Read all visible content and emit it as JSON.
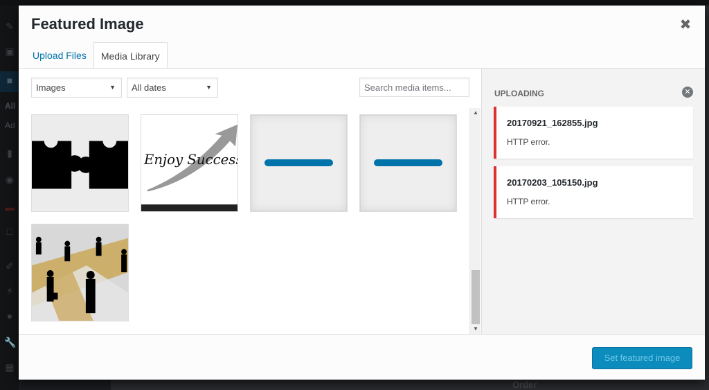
{
  "background_admin": {
    "sidebar_labels": [
      "All",
      "Ad"
    ],
    "below_modal_text": "Order"
  },
  "modal": {
    "title": "Featured Image",
    "close_icon": "close-icon",
    "tabs": [
      {
        "label": "Upload Files",
        "active": false
      },
      {
        "label": "Media Library",
        "active": true
      }
    ],
    "filters": {
      "type_select": {
        "selected": "Images"
      },
      "date_select": {
        "selected": "All dates"
      },
      "search": {
        "placeholder": "Search media items...",
        "value": ""
      }
    },
    "attachments": [
      {
        "type": "image",
        "description": "puzzle pieces"
      },
      {
        "type": "image",
        "description": "Enjoy Success arrow",
        "text": "Enjoy Success"
      },
      {
        "type": "uploading",
        "description": "upload in progress"
      },
      {
        "type": "uploading",
        "description": "upload in progress"
      },
      {
        "type": "image",
        "description": "business people on money"
      }
    ],
    "sidebar": {
      "title": "Uploading",
      "dismiss_icon": "dismiss-errors-icon",
      "errors": [
        {
          "filename": "20170921_162855.jpg",
          "message": "HTTP error."
        },
        {
          "filename": "20170203_105150.jpg",
          "message": "HTTP error."
        }
      ]
    },
    "toolbar": {
      "primary_button": "Set featured image",
      "primary_disabled": true
    },
    "colors": {
      "accent": "#0073aa",
      "button": "#0085ba",
      "error": "#dc3232"
    }
  }
}
